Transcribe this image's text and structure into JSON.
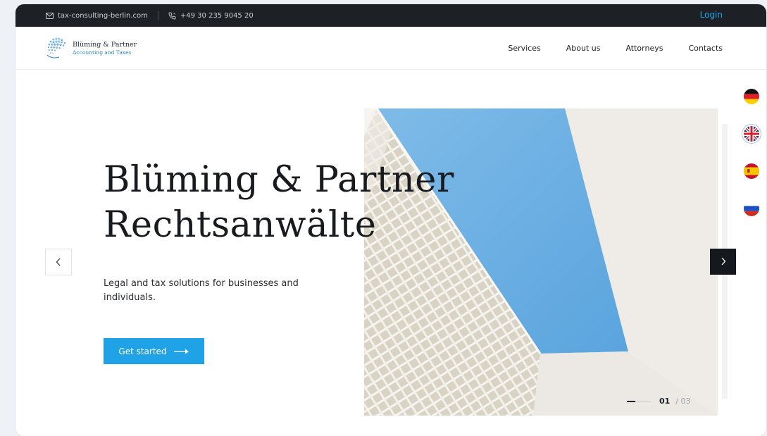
{
  "topbar": {
    "email": "tax-consulting-berlin.com",
    "phone": "+49 30 235 9045 20",
    "login_label": "Login",
    "mail_icon": "mail-icon",
    "phone_icon": "phone-icon"
  },
  "logo": {
    "name": "Blüming & Partner",
    "tagline": "Accounting and Taxes"
  },
  "nav": {
    "items": [
      {
        "label": "Services"
      },
      {
        "label": "About us"
      },
      {
        "label": "Attorneys"
      },
      {
        "label": "Contacts"
      }
    ]
  },
  "hero": {
    "title_line1": "Blüming & Partner",
    "title_line2": "Rechtsanwälte",
    "subtitle": "Legal and tax solutions for businesses and individuals.",
    "cta_label": "Get started",
    "cta_icon": "arrow-right-icon"
  },
  "slider": {
    "current": "01",
    "separator": "/",
    "total": "03",
    "prev_icon": "chevron-left-icon",
    "next_icon": "chevron-right-icon"
  },
  "languages": [
    {
      "code": "de",
      "icon": "flag-germany-icon",
      "selected": false
    },
    {
      "code": "en",
      "icon": "flag-uk-icon",
      "selected": true
    },
    {
      "code": "es",
      "icon": "flag-spain-icon",
      "selected": false
    },
    {
      "code": "ru",
      "icon": "flag-russia-icon",
      "selected": false
    }
  ],
  "colors": {
    "accent": "#1fa3e6",
    "topbar_bg": "#1d2126",
    "sky": "#6fb1e3"
  }
}
